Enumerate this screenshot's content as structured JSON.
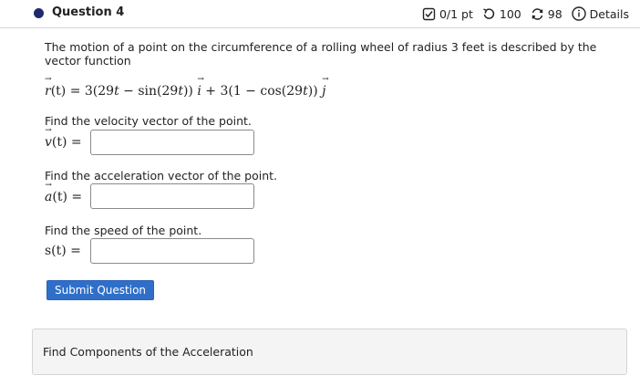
{
  "question": {
    "title": "Question 4",
    "score": "0/1 pt",
    "retries": "100",
    "attempts": "98",
    "details_label": "Details"
  },
  "icons": {
    "score": "checkbox-icon",
    "retries": "undo-icon",
    "attempts": "refresh-icon",
    "details": "info-icon"
  },
  "problem": {
    "text": "The motion of a point on the circumference of a rolling wheel of radius 3 feet is described by the vector function",
    "function_lhs": "(t) = ",
    "function_rhs_a": "3(29",
    "function_rhs_b": "t",
    "function_rhs_c": " − sin(29",
    "function_rhs_d": "t",
    "function_rhs_e": ")) ",
    "function_rhs_f": " + 3(1 − cos(29",
    "function_rhs_g": "t",
    "function_rhs_h": ")) "
  },
  "parts": [
    {
      "prompt": "Find the velocity vector of the point.",
      "label": "(t) =",
      "value": ""
    },
    {
      "prompt": "Find the acceleration vector of the point.",
      "label": "(t) =",
      "value": ""
    },
    {
      "prompt": "Find the speed of the point.",
      "label": "s(t) =",
      "value": ""
    }
  ],
  "submit_label": "Submit Question",
  "help_panel": {
    "text": "Find Components of the Acceleration"
  },
  "colors": {
    "accent": "#2f6fc9",
    "dot": "#1f2a6e",
    "panel_bg": "#f4f4f4"
  }
}
